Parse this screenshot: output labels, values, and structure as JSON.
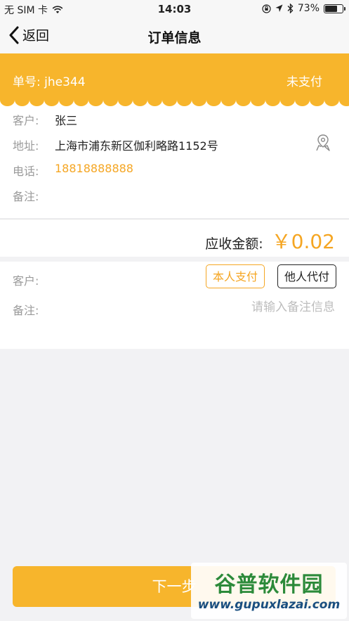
{
  "status_bar": {
    "carrier": "无 SIM 卡",
    "time": "14:03",
    "battery": "73%",
    "battery_level": 0.73,
    "icons": [
      "wifi-icon",
      "orientation-lock-icon",
      "location-icon",
      "bluetooth-icon",
      "battery-icon"
    ]
  },
  "nav": {
    "back_label": "返回",
    "title": "订单信息"
  },
  "order": {
    "number": "单号: jhe344",
    "status": "未支付"
  },
  "customer": {
    "name_label": "客户:",
    "name": "张三",
    "address_label": "地址:",
    "address": "上海市浦东新区伽利略路1152号",
    "phone_label": "电话:",
    "phone": "18818888888",
    "remark_label": "备注:",
    "remark": ""
  },
  "amount": {
    "label": "应收金额:",
    "value": "￥0.02"
  },
  "payer": {
    "label": "客户:",
    "option_self": "本人支付",
    "option_other": "他人代付",
    "remark_label": "备注:",
    "remark_placeholder": "请输入备注信息"
  },
  "next_button": "下一步",
  "watermark": {
    "title": "谷普软件园",
    "url": "www.gupuxlazai.com"
  },
  "colors": {
    "accent": "#f7b52c",
    "highlight": "#f5a623"
  }
}
